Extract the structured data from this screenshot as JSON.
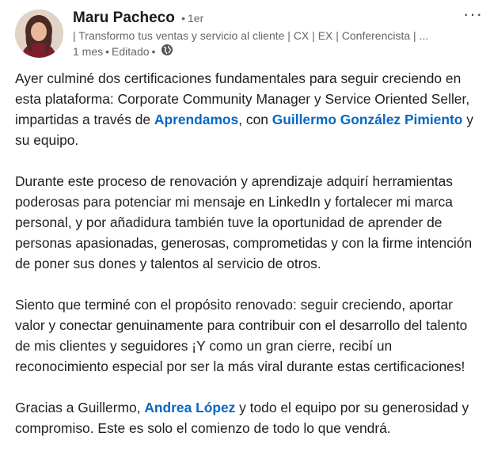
{
  "post": {
    "author": {
      "name": "Maru Pacheco",
      "degree": "1er",
      "headline": "| Transformo tus ventas y servicio al cliente | CX | EX | Conferencista | ...",
      "time": "1 mes",
      "edited": "Editado",
      "separator": "•",
      "visibility_icon": "globe-icon"
    },
    "more_icon": "more-horizontal-icon",
    "colors": {
      "link": "#0a66c2",
      "text": "#1f1f1f",
      "meta": "#666666"
    },
    "paragraphs": {
      "p1": {
        "t1": "Ayer culminé dos certificaciones fundamentales para seguir creciendo en esta plataforma: Corporate Community Manager y Service Oriented Seller, impartidas a través de ",
        "m1": "Aprendamos",
        "t2": ", con ",
        "m2": "Guillermo González Pimiento",
        "t3": " y su equipo."
      },
      "p2": "Durante este proceso de renovación y aprendizaje adquirí herramientas poderosas para potenciar mi mensaje en LinkedIn y fortalecer mi marca personal, y por añadidura también tuve la oportunidad de aprender de personas apasionadas, generosas, comprometidas y con la firme intención de poner sus dones y talentos al servicio de otros.",
      "p3": "Siento que terminé con el propósito renovado: seguir creciendo, aportar valor y conectar genuinamente para contribuir con el desarrollo del talento de mis clientes y seguidores ¡Y como un gran cierre, recibí un reconocimiento especial por ser la más viral durante estas certificaciones!",
      "p4": {
        "t1": "Gracias a Guillermo, ",
        "m1": "Andrea López",
        "t2": " y todo el equipo por su generosidad y compromiso. Este es solo el comienzo de todo lo que vendrá."
      }
    }
  }
}
